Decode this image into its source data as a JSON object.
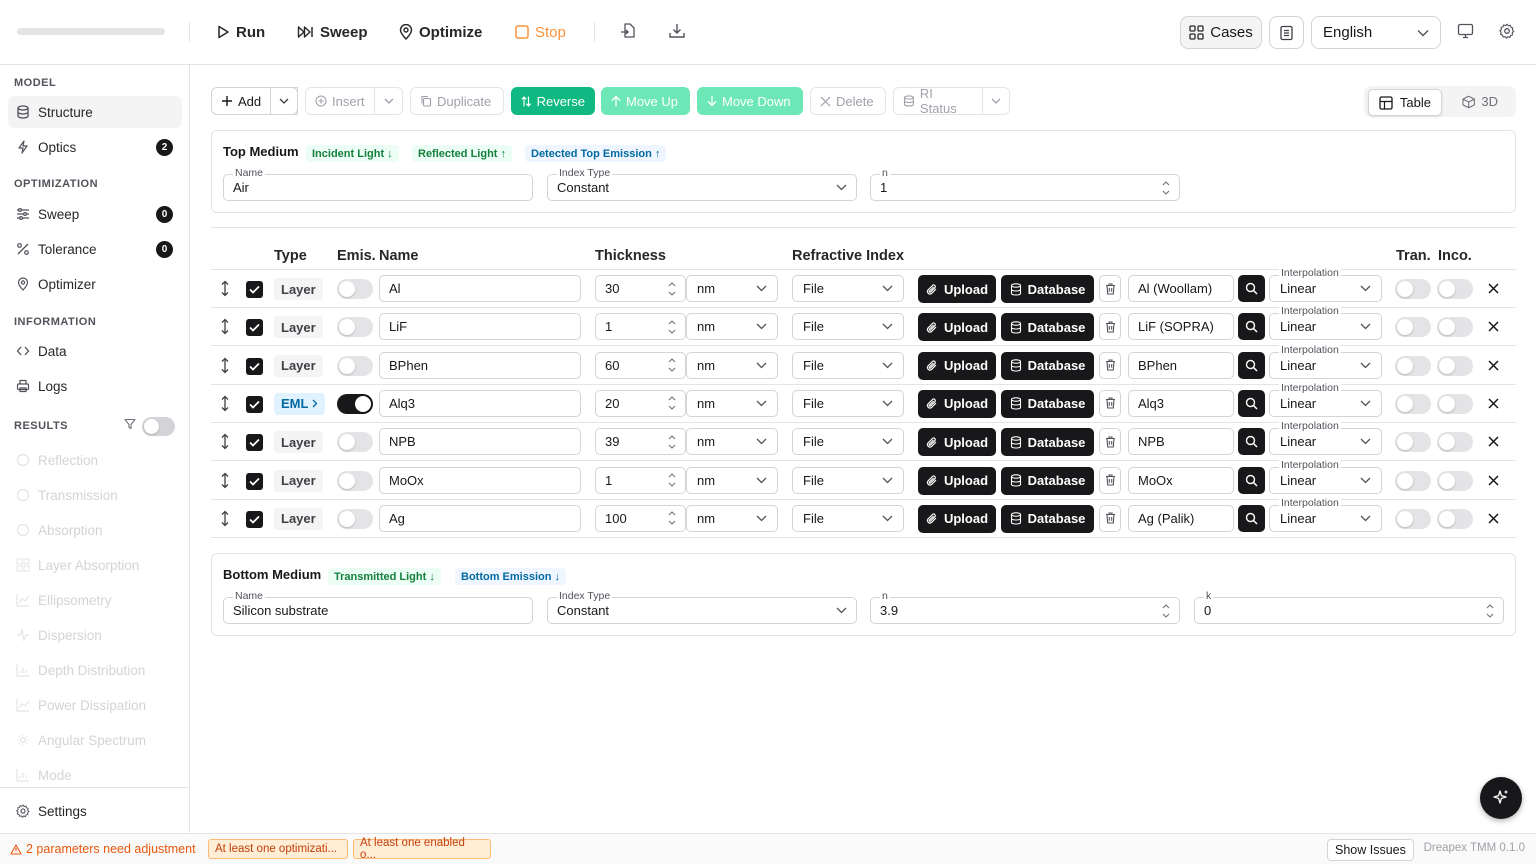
{
  "toolbar": {
    "run": "Run",
    "sweep": "Sweep",
    "optimize": "Optimize",
    "stop": "Stop",
    "cases": "Cases",
    "language": "English"
  },
  "sidebar": {
    "model_label": "MODEL",
    "structure": "Structure",
    "optics": "Optics",
    "optics_badge": "2",
    "optimization_label": "OPTIMIZATION",
    "sweep": "Sweep",
    "sweep_badge": "0",
    "tolerance": "Tolerance",
    "tolerance_badge": "0",
    "optimizer": "Optimizer",
    "information_label": "INFORMATION",
    "data": "Data",
    "logs": "Logs",
    "results_label": "RESULTS",
    "results": [
      "Reflection",
      "Transmission",
      "Absorption",
      "Layer Absorption",
      "Ellipsometry",
      "Dispersion",
      "Depth Distribution",
      "Power Dissipation",
      "Angular Spectrum",
      "Mode"
    ],
    "settings": "Settings"
  },
  "actions": {
    "add": "Add",
    "insert": "Insert",
    "duplicate": "Duplicate",
    "reverse": "Reverse",
    "move_up": "Move Up",
    "move_down": "Move Down",
    "delete": "Delete",
    "ri_status": "RI Status",
    "view_table": "Table",
    "view_3d": "3D"
  },
  "top_medium": {
    "title": "Top Medium",
    "tags": [
      "Incident Light ↓",
      "Reflected Light ↑",
      "Detected Top Emission ↑"
    ],
    "name_label": "Name",
    "name": "Air",
    "index_type_label": "Index Type",
    "index_type": "Constant",
    "n_label": "n",
    "n": "1"
  },
  "table": {
    "headers": {
      "type": "Type",
      "emis": "Emis.",
      "name": "Name",
      "thickness": "Thickness",
      "ri": "Refractive Index",
      "tran": "Tran.",
      "inco": "Inco."
    },
    "upload": "Upload",
    "database": "Database",
    "interp_label": "Interpolation",
    "rows": [
      {
        "type": "Layer",
        "emis": false,
        "name": "Al",
        "thickness": "30",
        "unit": "nm",
        "source": "File",
        "material": "Al (Woollam)",
        "interp": "Linear"
      },
      {
        "type": "Layer",
        "emis": false,
        "name": "LiF",
        "thickness": "1",
        "unit": "nm",
        "source": "File",
        "material": "LiF (SOPRA)",
        "interp": "Linear"
      },
      {
        "type": "Layer",
        "emis": false,
        "name": "BPhen",
        "thickness": "60",
        "unit": "nm",
        "source": "File",
        "material": "BPhen",
        "interp": "Linear"
      },
      {
        "type": "EML",
        "emis": true,
        "name": "Alq3",
        "thickness": "20",
        "unit": "nm",
        "source": "File",
        "material": "Alq3",
        "interp": "Linear"
      },
      {
        "type": "Layer",
        "emis": false,
        "name": "NPB",
        "thickness": "39",
        "unit": "nm",
        "source": "File",
        "material": "NPB",
        "interp": "Linear"
      },
      {
        "type": "Layer",
        "emis": false,
        "name": "MoOx",
        "thickness": "1",
        "unit": "nm",
        "source": "File",
        "material": "MoOx",
        "interp": "Linear"
      },
      {
        "type": "Layer",
        "emis": false,
        "name": "Ag",
        "thickness": "100",
        "unit": "nm",
        "source": "File",
        "material": "Ag (Palik)",
        "interp": "Linear"
      }
    ]
  },
  "bottom_medium": {
    "title": "Bottom Medium",
    "tags": [
      "Transmitted Light ↓",
      "Bottom Emission ↓"
    ],
    "name_label": "Name",
    "name": "Silicon substrate",
    "index_type_label": "Index Type",
    "index_type": "Constant",
    "n_label": "n",
    "n": "3.9",
    "k_label": "k",
    "k": "0"
  },
  "status": {
    "issues": "2 parameters need adjustment",
    "pills": [
      "At least one optimizati...",
      "At least one enabled o..."
    ],
    "show_issues": "Show Issues",
    "version": "Dreapex TMM 0.1.0"
  }
}
